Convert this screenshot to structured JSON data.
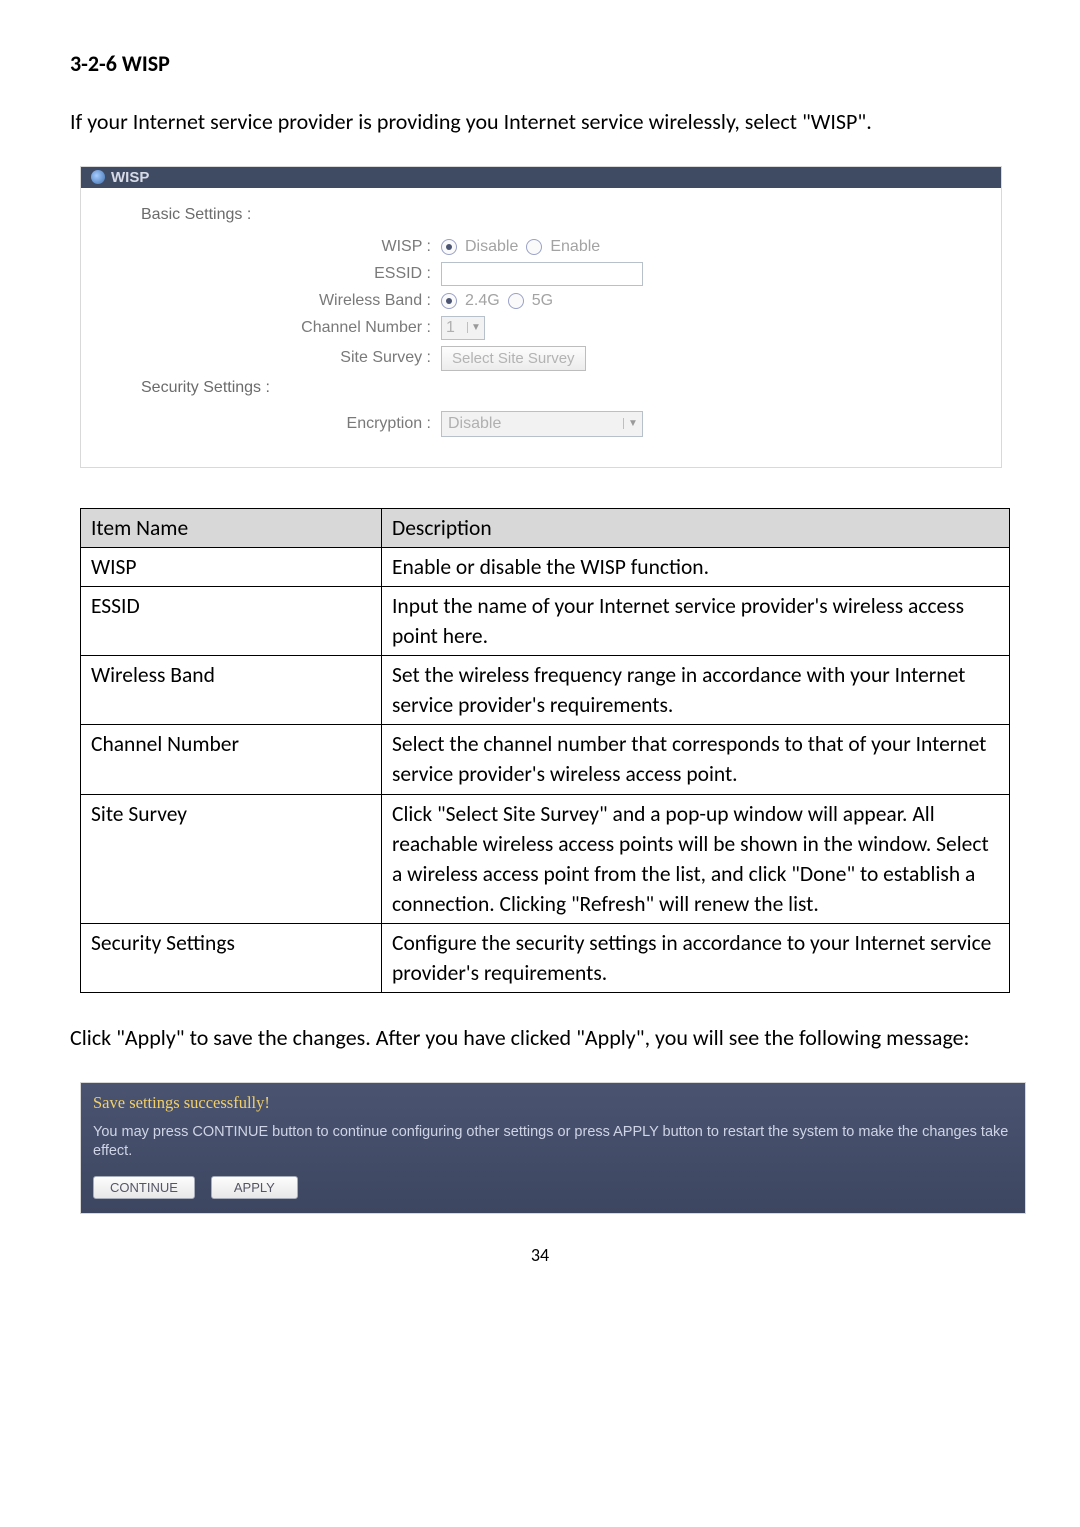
{
  "heading": "3-2-6 WISP",
  "intro": "If your Internet service provider is providing you Internet service wirelessly, select \"WISP\".",
  "panel": {
    "title": "WISP",
    "basic_settings_label": "Basic Settings :",
    "rows": {
      "wisp_label": "WISP :",
      "wisp_opt_disable": "Disable",
      "wisp_opt_enable": "Enable",
      "essid_label": "ESSID :",
      "essid_value": "",
      "band_label": "Wireless Band :",
      "band_opt_24": "2.4G",
      "band_opt_5": "5G",
      "channel_label": "Channel Number :",
      "channel_value": "1",
      "survey_label": "Site Survey :",
      "survey_button": "Select Site Survey",
      "security_settings_label": "Security Settings :",
      "encryption_label": "Encryption :",
      "encryption_value": "Disable"
    }
  },
  "table": {
    "h1": "Item Name",
    "h2": "Description",
    "rows": [
      {
        "name": "WISP",
        "desc": "Enable or disable the WISP function."
      },
      {
        "name": "ESSID",
        "desc": "Input the name of your Internet service provider's wireless access point here."
      },
      {
        "name": "Wireless Band",
        "desc": "Set the wireless frequency range in accordance with your Internet service provider's requirements."
      },
      {
        "name": "Channel Number",
        "desc": "Select the channel number that corresponds to that of your Internet service provider's wireless access point."
      },
      {
        "name": "Site Survey",
        "desc": "Click \"Select Site Survey\" and a pop-up window will appear. All reachable wireless access points will be shown in the window. Select a wireless access point from the list, and click \"Done\" to establish a connection. Clicking \"Refresh\" will renew the list."
      },
      {
        "name": "Security Settings",
        "desc": "Configure the security settings in accordance to your Internet service provider's requirements."
      }
    ]
  },
  "apply_para": "Click \"Apply\" to save the changes. After you have clicked \"Apply\", you will see the following message:",
  "confirm": {
    "title": "Save settings successfully!",
    "msg": "You may press CONTINUE button to continue configuring other settings or press APPLY button to restart the system to make the changes take effect.",
    "continue": "CONTINUE",
    "apply": "APPLY"
  },
  "page_number": "34"
}
